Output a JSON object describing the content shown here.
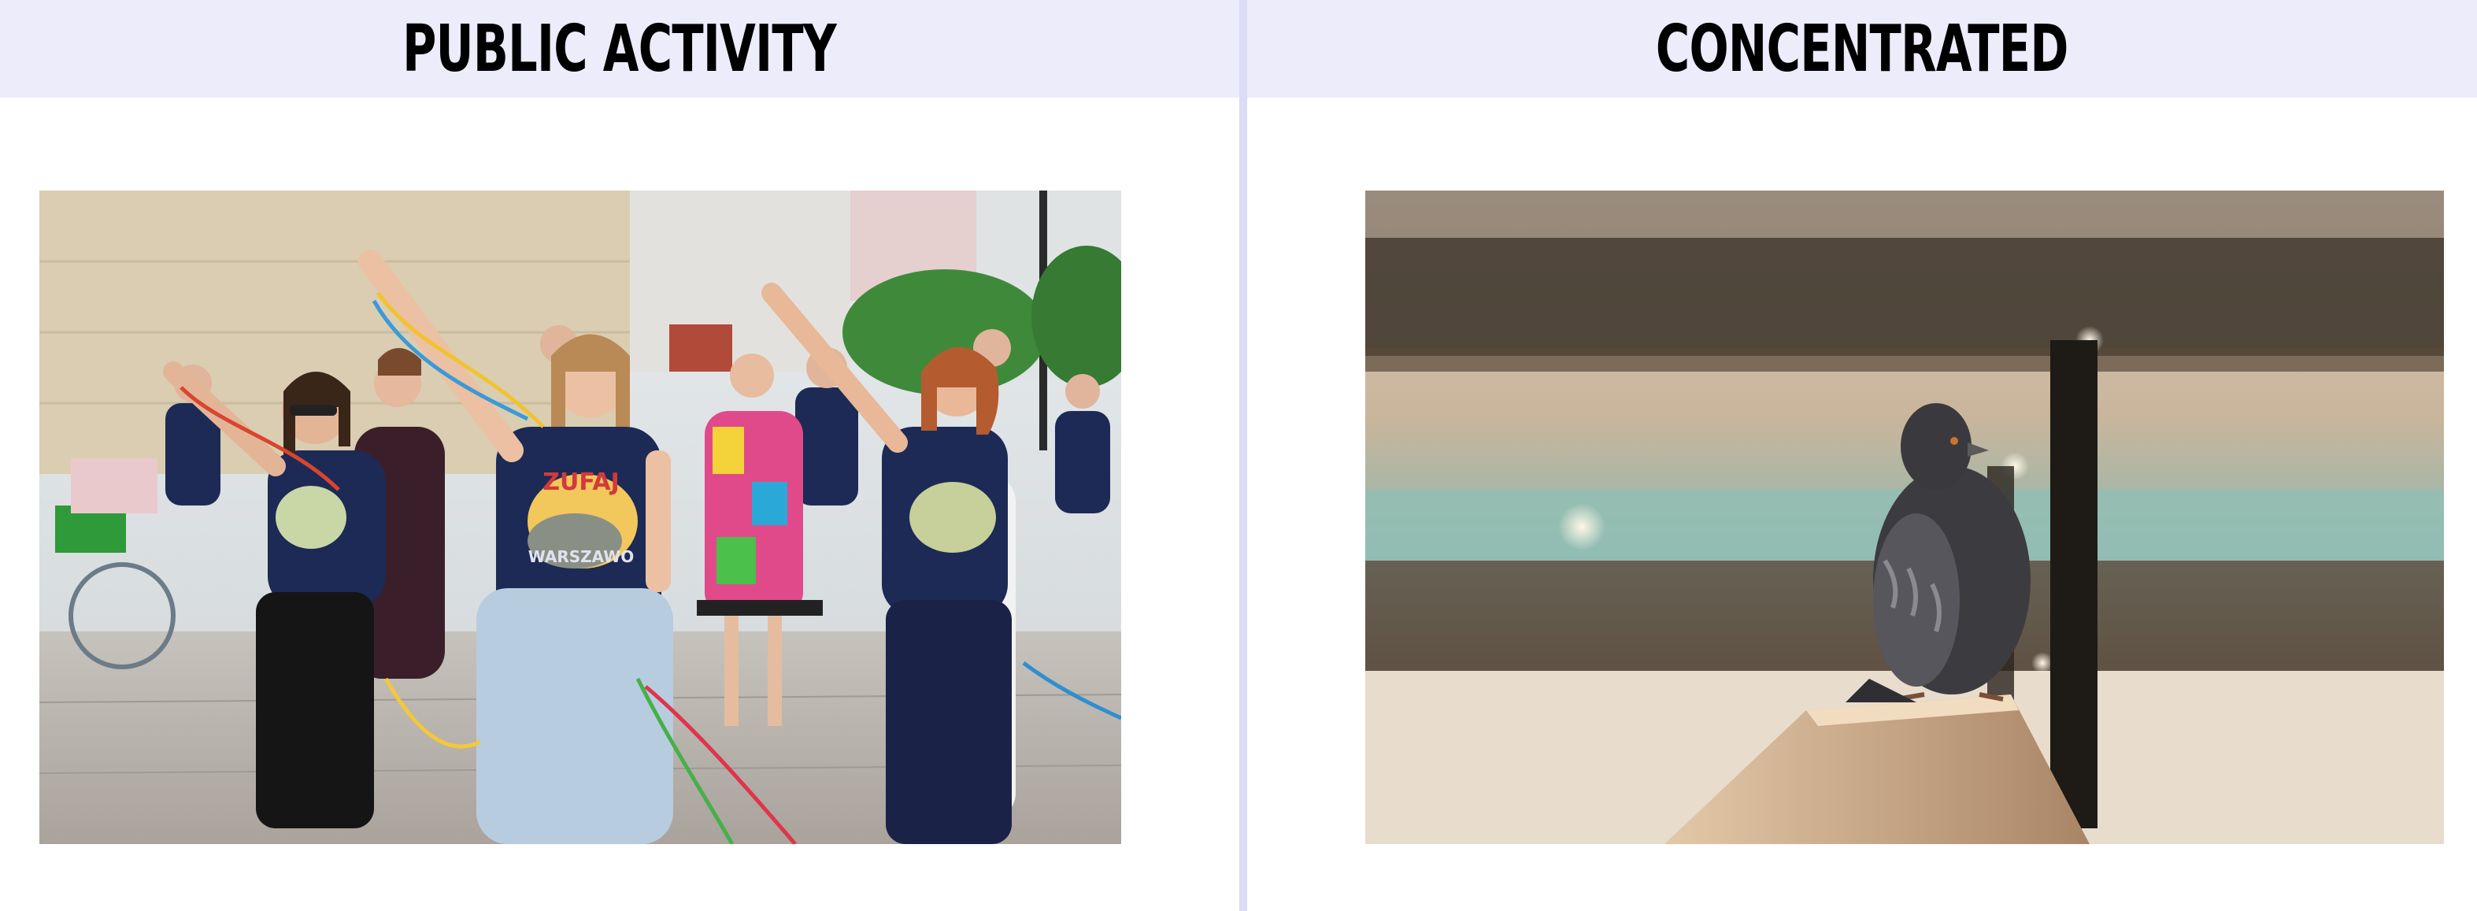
{
  "panels": [
    {
      "title": "PUBLIC ACTIVITY",
      "image": {
        "subject": "crowd-dancing-with-ribbons-photo",
        "palette": {
          "wall": "#d9cdb0",
          "pavement": "#b9b4ad",
          "shirt": "#1c2a55",
          "skirt": "#b8cce0",
          "foliage": "#3f8a3a"
        }
      },
      "shirt_texts": [
        "ZUFAJ",
        "WARSZAWO"
      ]
    },
    {
      "title": "CONCENTRATED",
      "image": {
        "subject": "pigeon-on-railing-photo",
        "palette": {
          "sky": "#e9dccb",
          "bridge": "#3a3128",
          "water": "#8fb7ae",
          "rail": "#c9a683",
          "pigeon": "#3c3b40"
        }
      }
    }
  ],
  "colors": {
    "header_bg": "#ececfb",
    "divider": "#dcdcf6",
    "title": "#000000"
  }
}
